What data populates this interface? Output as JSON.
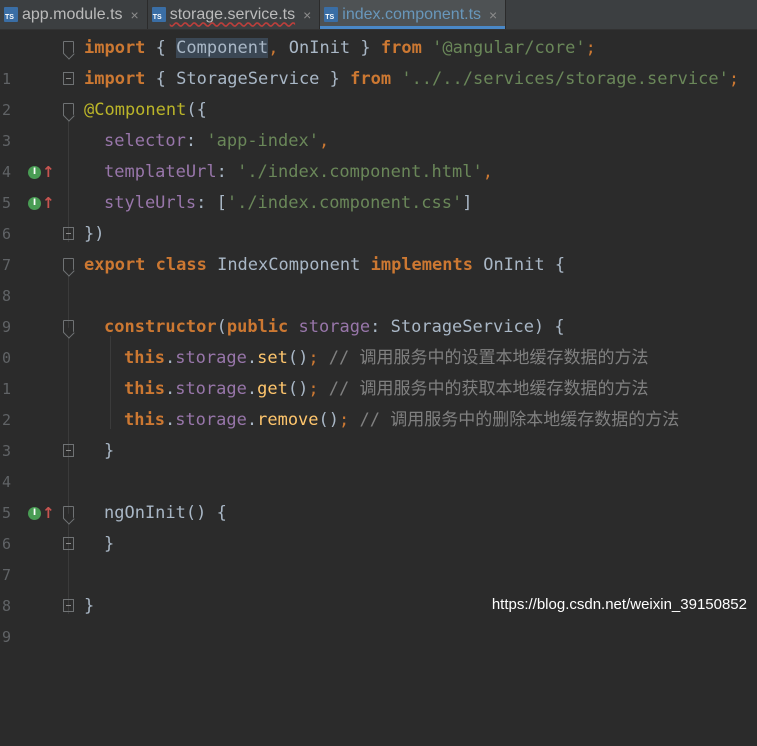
{
  "tabs": [
    {
      "label": "app.module.ts",
      "icon": "TS",
      "active": false,
      "error": false
    },
    {
      "label": "storage.service.ts",
      "icon": "TS",
      "active": false,
      "error": true
    },
    {
      "label": "index.component.ts",
      "icon": "TS",
      "active": true,
      "error": false
    }
  ],
  "tab_close_glyph": "×",
  "line_numbers": [
    "1",
    "2",
    "3",
    "4",
    "5",
    "6",
    "7",
    "8",
    "9",
    "0",
    "1",
    "2",
    "3",
    "4",
    "5",
    "6",
    "7",
    "8",
    "9"
  ],
  "code": {
    "l1": {
      "kw_import": "import",
      "p1": " { ",
      "component": "Component",
      "comma": ",",
      "oninit": " OnInit",
      "p2": " } ",
      "kw_from": "from",
      "sp": " ",
      "str": "'@angular/core'",
      "semi": ";"
    },
    "l2": {
      "kw_import": "import",
      "p1": " { StorageService } ",
      "kw_from": "from",
      "sp": " ",
      "str": "'../../services/storage.service'",
      "semi": ";"
    },
    "l3": {
      "ann": "@Component",
      "p": "({"
    },
    "l4": {
      "prop": "selector",
      "colon": ": ",
      "str": "'app-index'",
      "comma": ","
    },
    "l5": {
      "prop": "templateUrl",
      "colon": ": ",
      "str": "'./index.component.html'",
      "comma": ","
    },
    "l6": {
      "prop": "styleUrls",
      "colon": ": [",
      "str": "'./index.component.css'",
      "end": "]"
    },
    "l7": {
      "p": "})"
    },
    "l8": {
      "kw_export": "export",
      "kw_class": " class",
      "name": " IndexComponent ",
      "kw_impl": "implements",
      "rest": " OnInit {"
    },
    "l10": {
      "fn": "constructor",
      "p1": "(",
      "kw_public": "public",
      "sp": " ",
      "prop": "storage",
      "rest": ": StorageService) {"
    },
    "l11": {
      "kw_this": "this",
      "dot": ".",
      "prop": "storage",
      "dot2": ".",
      "fn": "set",
      "call": "()",
      "semi": "; ",
      "cm": "// 调用服务中的设置本地缓存数据的方法"
    },
    "l12": {
      "kw_this": "this",
      "dot": ".",
      "prop": "storage",
      "dot2": ".",
      "fn": "get",
      "call": "()",
      "semi": "; ",
      "cm": "// 调用服务中的获取本地缓存数据的方法"
    },
    "l13": {
      "kw_this": "this",
      "dot": ".",
      "prop": "storage",
      "dot2": ".",
      "fn": "remove",
      "call": "()",
      "semi": "; ",
      "cm": "// 调用服务中的删除本地缓存数据的方法"
    },
    "l14": {
      "p": "}"
    },
    "l16": {
      "fn": "ngOnInit",
      "rest": "() {"
    },
    "l17": {
      "p": "}"
    },
    "l19": {
      "p": "}"
    }
  },
  "gutter_marker": {
    "badge": "I",
    "arrow": "↑"
  },
  "watermark": "https://blog.csdn.net/weixin_39150852",
  "colors": {
    "background": "#2b2b2b",
    "keyword": "#cc7832",
    "string": "#6a8759",
    "property": "#9876aa",
    "function": "#ffc66d",
    "comment": "#808080",
    "annotation": "#bbb529",
    "text": "#a9b7c6"
  }
}
